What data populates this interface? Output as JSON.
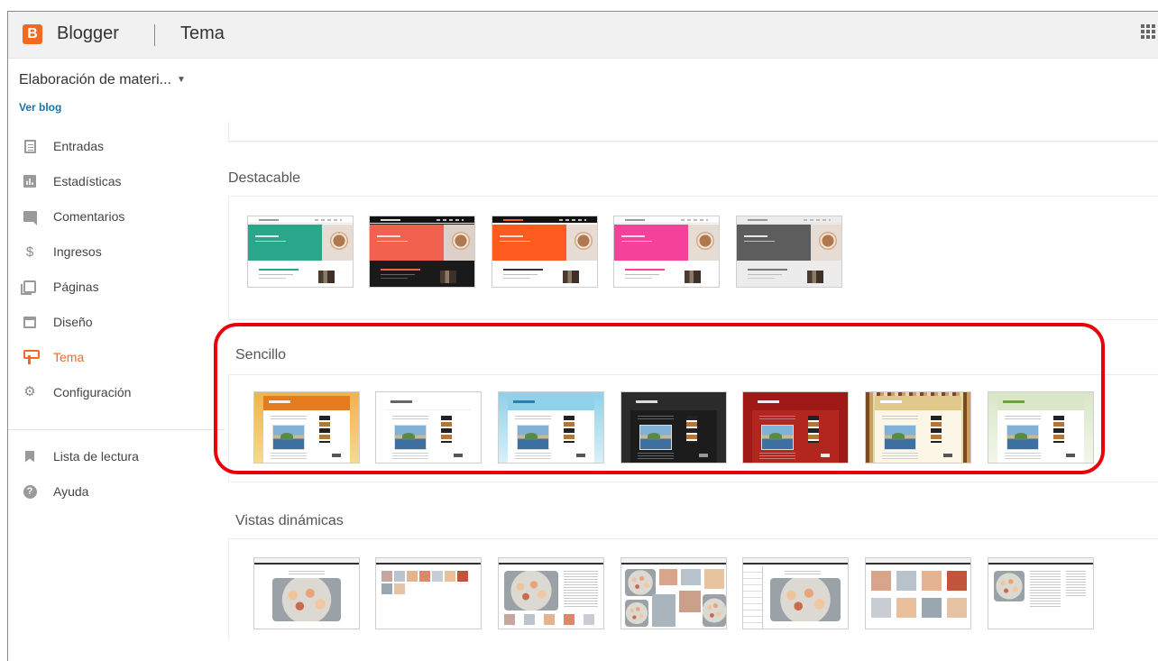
{
  "app": {
    "brand": "Blogger",
    "logo_letter": "B",
    "section": "Tema"
  },
  "blog": {
    "name": "Elaboración de materi...",
    "view_link": "Ver blog"
  },
  "sidebar": {
    "items": [
      {
        "label": "Entradas",
        "icon": "posts-icon"
      },
      {
        "label": "Estadísticas",
        "icon": "stats-icon"
      },
      {
        "label": "Comentarios",
        "icon": "comments-icon"
      },
      {
        "label": "Ingresos",
        "icon": "dollar-icon"
      },
      {
        "label": "Páginas",
        "icon": "pages-icon"
      },
      {
        "label": "Diseño",
        "icon": "layout-icon"
      },
      {
        "label": "Tema",
        "icon": "theme-icon",
        "active": true
      },
      {
        "label": "Configuración",
        "icon": "gear-icon"
      }
    ],
    "secondary": [
      {
        "label": "Lista de lectura",
        "icon": "bookmark-icon"
      },
      {
        "label": "Ayuda",
        "icon": "help-icon"
      }
    ]
  },
  "categories": [
    {
      "label": "Destacable",
      "themes": [
        "#2aa68a",
        "#f0624d",
        "#ff5a1f",
        "#f5419a",
        "#5d5d5d"
      ]
    },
    {
      "label": "Sencillo",
      "themes": [
        "#f0a53a",
        "#ffffff",
        "#8fd1e8",
        "#2b2b2b",
        "#9f1a16",
        "#e7d8a6",
        "#d9e6c8"
      ]
    },
    {
      "label": "Vistas dinámicas",
      "count": 7
    }
  ],
  "colors": {
    "accent": "#f26a21",
    "link": "#1a73a8",
    "highlight": "#e8000b"
  }
}
